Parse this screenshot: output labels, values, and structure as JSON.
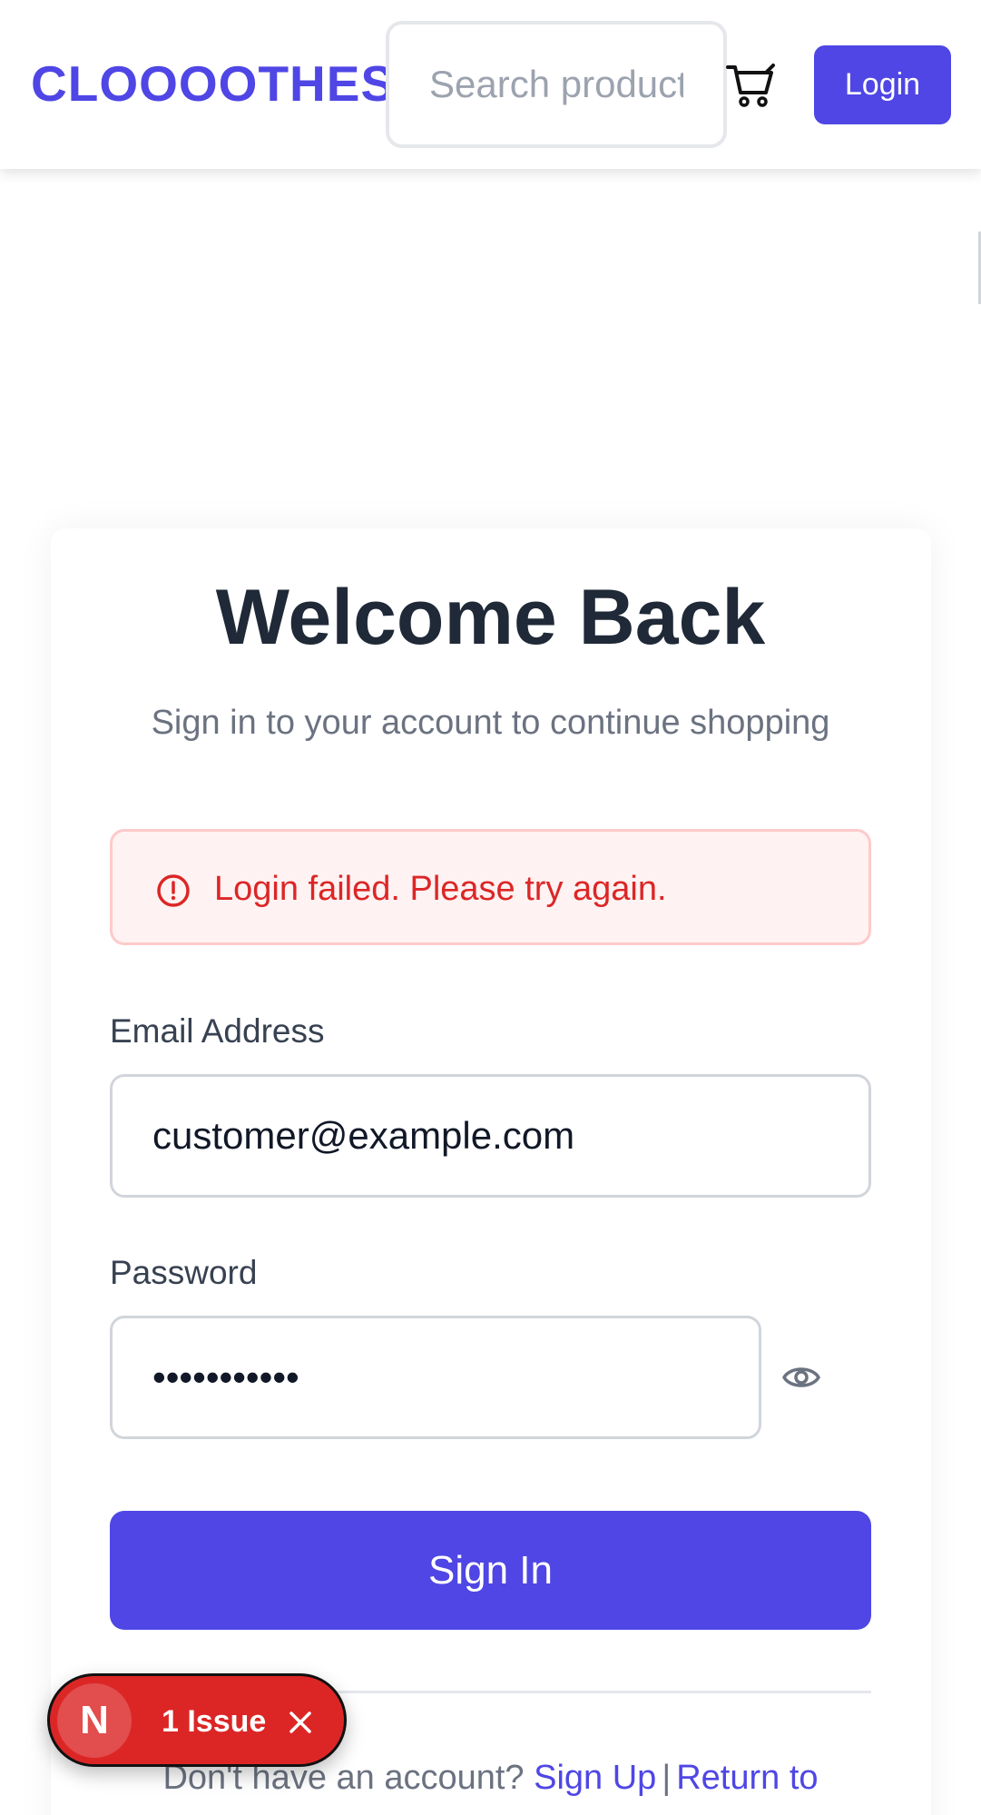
{
  "header": {
    "brand": "CLOOOOTHES",
    "search_placeholder": "Search products",
    "cart_icon": "cart-icon",
    "login_label": "Login"
  },
  "login": {
    "title": "Welcome Back",
    "subtitle": "Sign in to your account to continue shopping",
    "error": {
      "icon": "alert-circle-icon",
      "message": "Login failed. Please try again."
    },
    "email_label": "Email Address",
    "email_value": "customer@example.com",
    "password_label": "Password",
    "password_value": "password123",
    "show_password_icon": "eye-icon",
    "submit_label": "Sign In",
    "footer": {
      "prompt": "Don't have an account?",
      "signup_link": "Sign Up",
      "separator": "|",
      "return_link": "Return to"
    }
  },
  "dev_overlay": {
    "logo": "N",
    "issues_label": "1 Issue",
    "close_icon": "close-icon"
  },
  "colors": {
    "brand": "#4f46e5",
    "error": "#dc2626",
    "error_bg": "#fef2f2"
  }
}
